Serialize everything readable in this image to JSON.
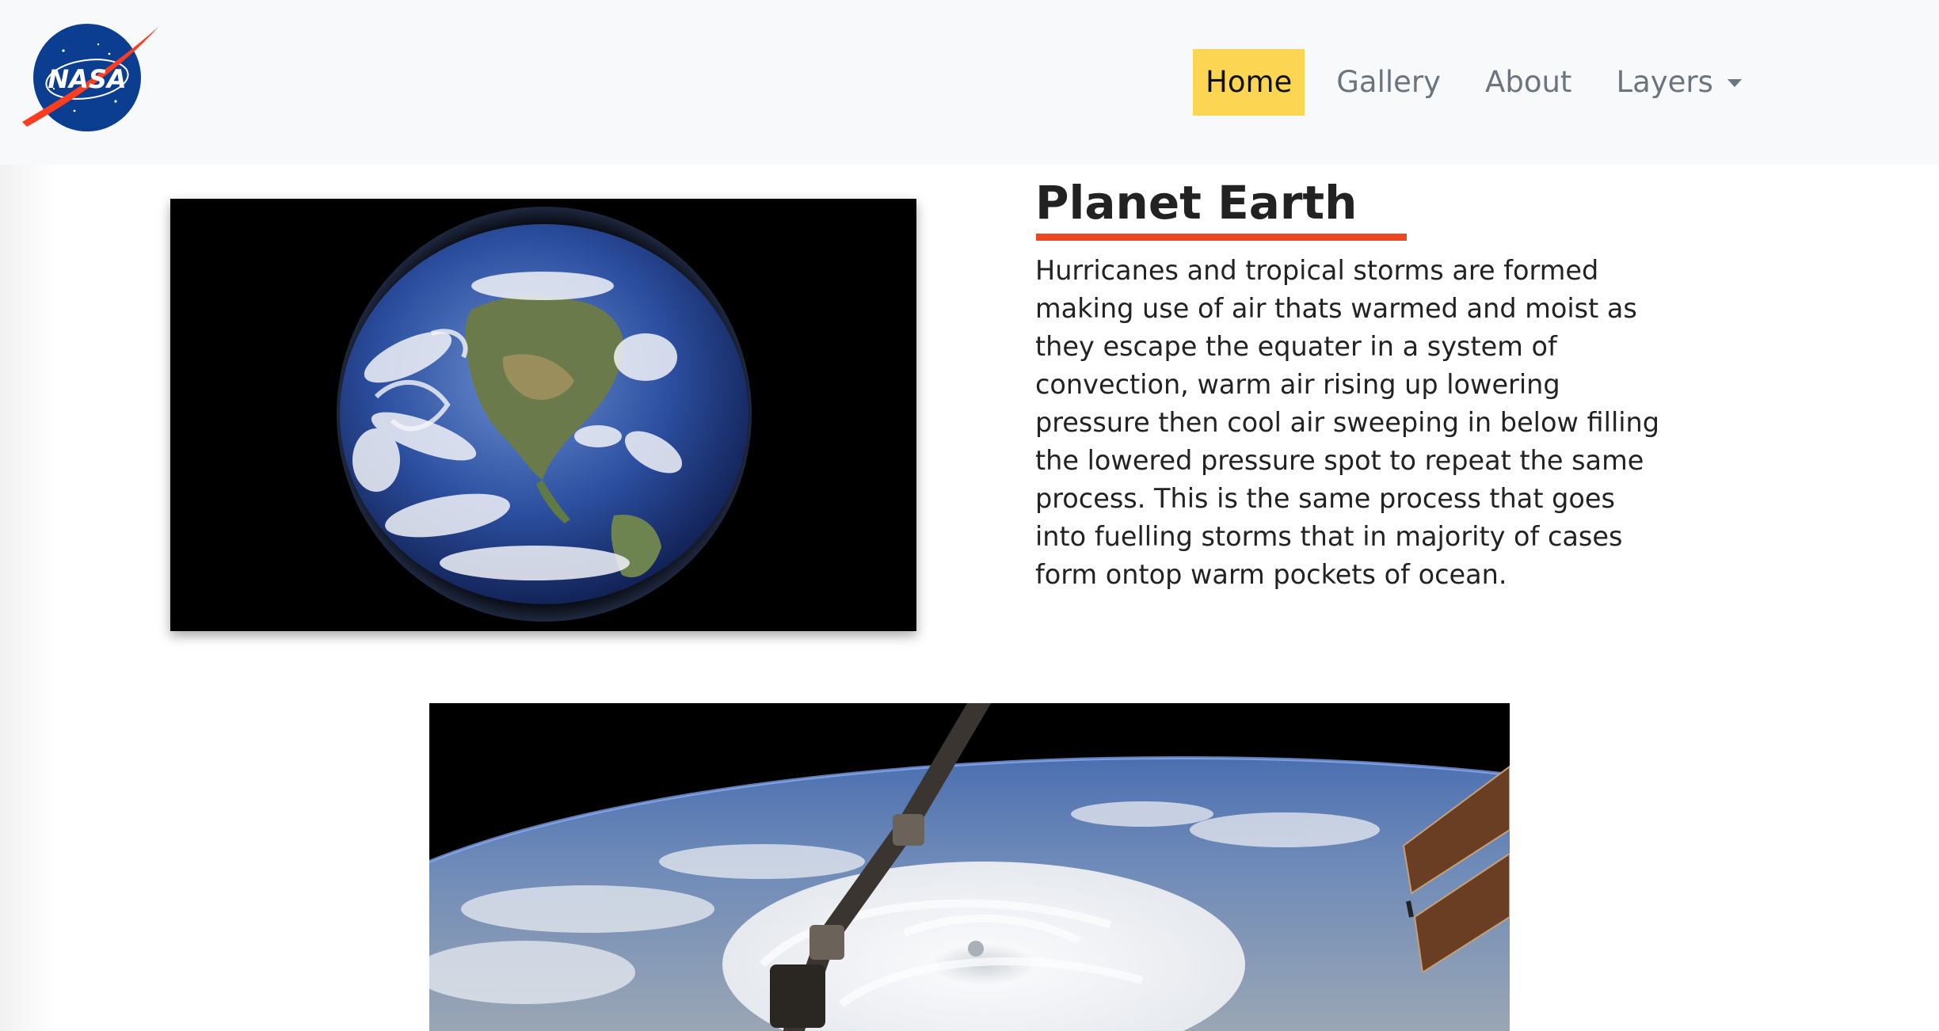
{
  "navbar": {
    "logo": {
      "icon": "nasa-meatball-logo",
      "text": "NASA",
      "colors": {
        "blue": "#0b3d91",
        "red": "#fc3d21"
      }
    },
    "links": [
      {
        "label": "Home",
        "active": true
      },
      {
        "label": "Gallery",
        "active": false
      },
      {
        "label": "About",
        "active": false
      },
      {
        "label": "Layers",
        "active": false,
        "dropdown": true
      }
    ],
    "active_color": "#fcd653"
  },
  "article": {
    "title": "Planet Earth",
    "accent_color": "#ee4522",
    "body": "Hurricanes and tropical storms are formed making use of air thats warmed and moist as they escape the equater in a system of convection, warm air rising up lowering pressure then cool air sweeping in below filling the lowered pressure spot to repeat the same process. This is the same process that goes into fuelling storms that in majority of cases form ontop warm pockets of ocean."
  },
  "images": {
    "earth": {
      "icon": "earth-from-space-image"
    },
    "hurricane": {
      "icon": "hurricane-from-iss-image"
    }
  }
}
